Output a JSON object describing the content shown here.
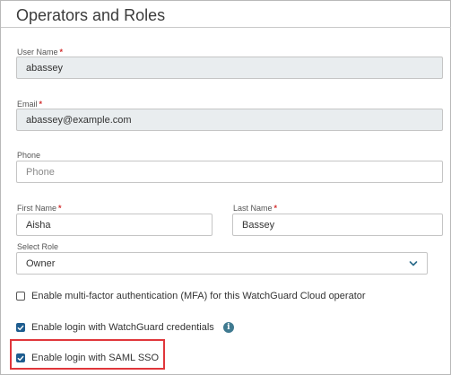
{
  "header": {
    "title": "Operators and Roles"
  },
  "form": {
    "username": {
      "label": "User Name",
      "value": "abassey"
    },
    "email": {
      "label": "Email",
      "value": "abassey@example.com"
    },
    "phone": {
      "label": "Phone",
      "placeholder": "Phone"
    },
    "first_name": {
      "label": "First Name",
      "value": "Aisha"
    },
    "last_name": {
      "label": "Last Name",
      "value": "Bassey"
    },
    "role": {
      "label": "Select Role",
      "value": "Owner"
    },
    "required_marker": "*"
  },
  "options": {
    "mfa": {
      "label": "Enable multi-factor authentication (MFA) for this WatchGuard Cloud operator",
      "checked": false
    },
    "watchguard_login": {
      "label": "Enable login with WatchGuard credentials",
      "checked": true
    },
    "saml_login": {
      "label": "Enable login with SAML SSO",
      "checked": true
    }
  },
  "icons": {
    "info": "i"
  },
  "colors": {
    "highlight": "#e0363b",
    "checkbox_checked": "#1e5d8f",
    "readonly_bg": "#e9edef"
  }
}
